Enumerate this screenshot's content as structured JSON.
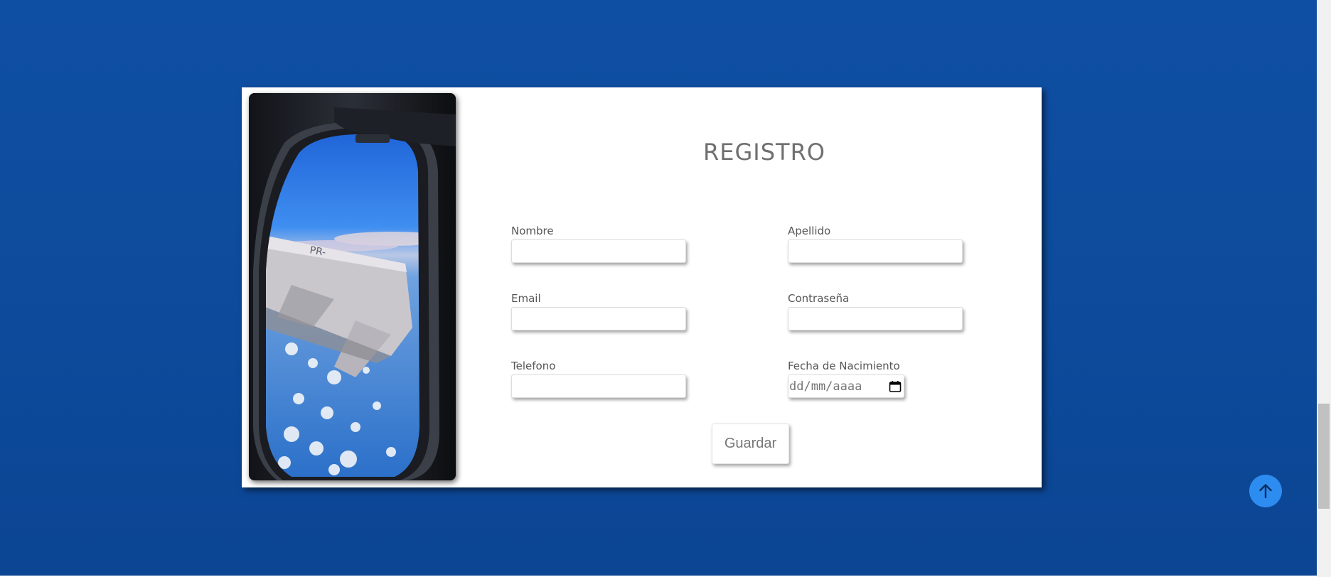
{
  "form": {
    "title": "REGISTRO",
    "fields": {
      "nombre": {
        "label": "Nombre",
        "value": ""
      },
      "apellido": {
        "label": "Apellido",
        "value": ""
      },
      "email": {
        "label": "Email",
        "value": ""
      },
      "contrasena": {
        "label": "Contraseña",
        "value": ""
      },
      "telefono": {
        "label": "Telefono",
        "value": ""
      },
      "fecha": {
        "label": "Fecha de Nacimiento",
        "placeholder": "dd/mm/aaaa"
      }
    },
    "submit_label": "Guardar"
  },
  "icons": {
    "calendar": "calendar-icon",
    "scroll_top": "arrow-up-icon"
  },
  "colors": {
    "background": "#0f4fa3",
    "card": "#ffffff",
    "title_text": "#6f6f6f",
    "scroll_top_button": "#2d8cf0"
  }
}
